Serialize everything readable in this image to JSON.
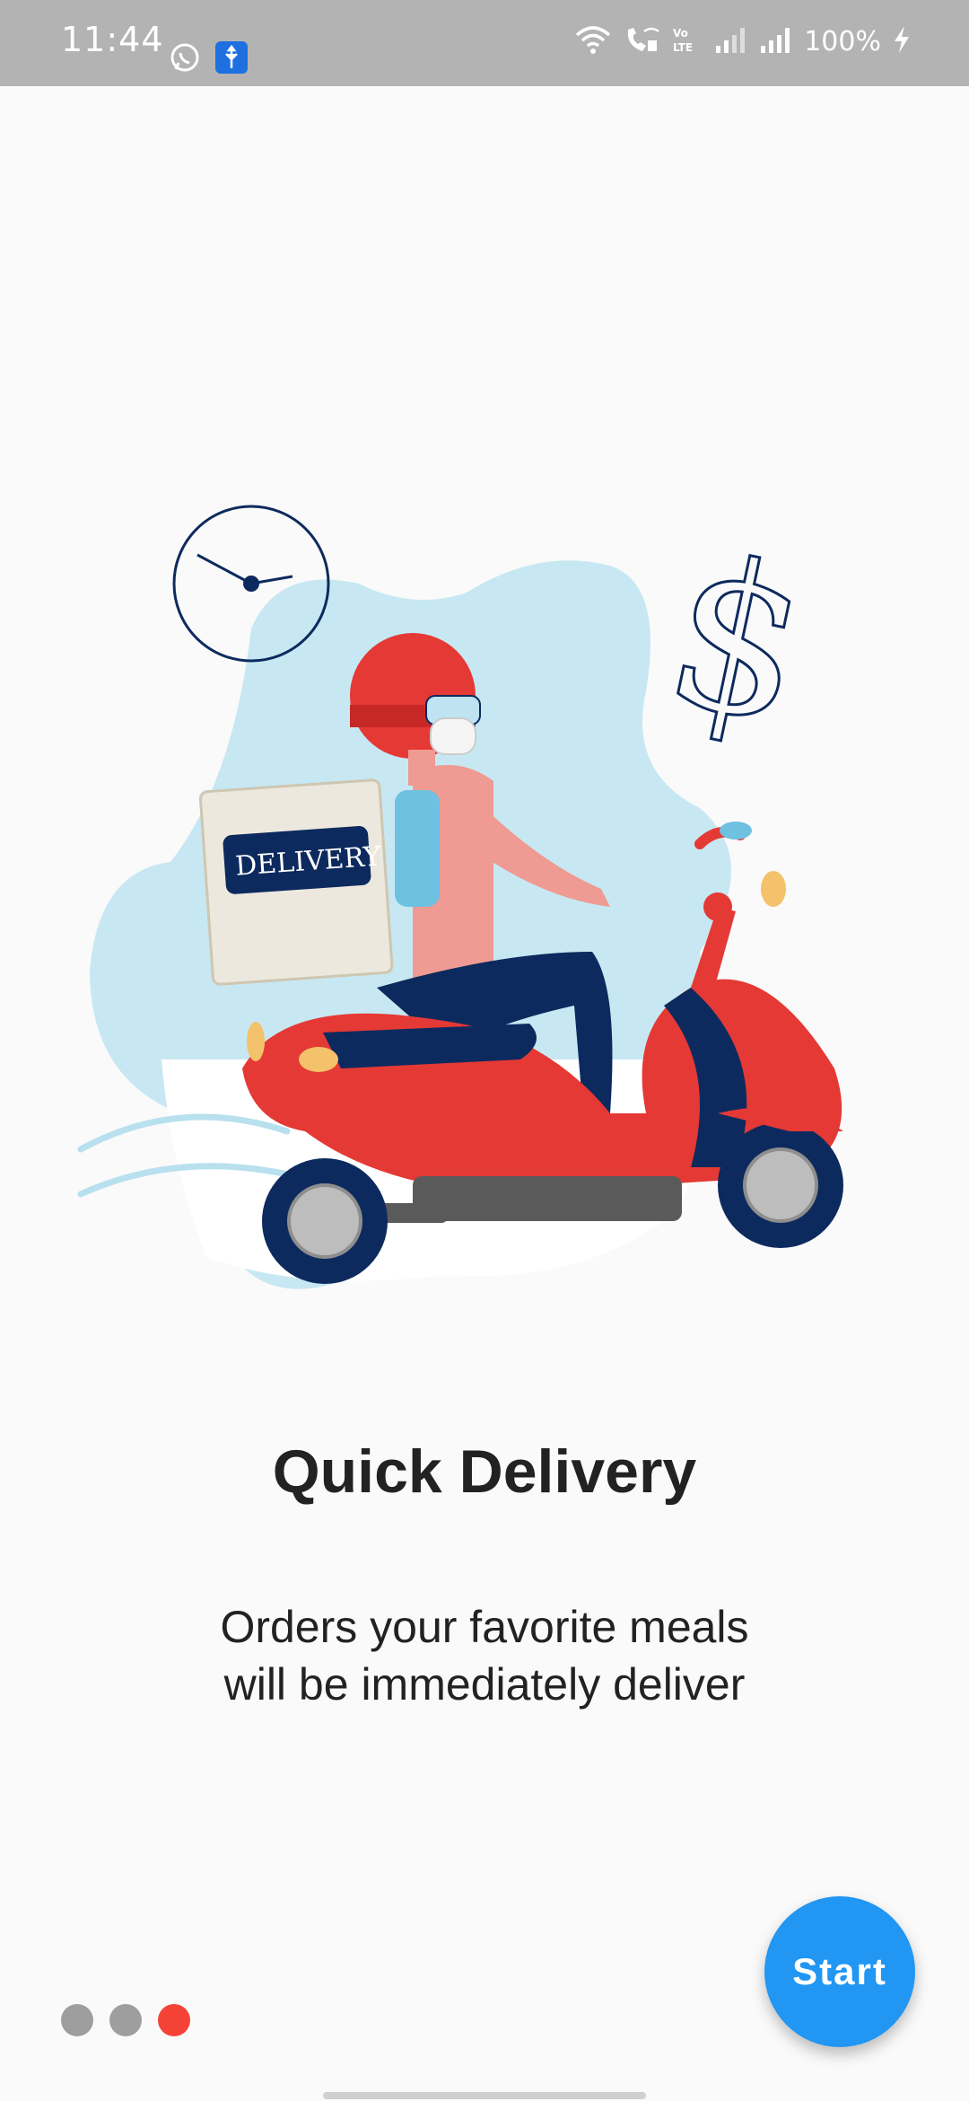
{
  "status_bar": {
    "time": "11:44",
    "battery": "100%",
    "icons": [
      "whatsapp-icon",
      "usb-icon",
      "wifi-icon",
      "wifi-calling-icon",
      "volte-icon",
      "signal-icon",
      "signal-icon",
      "charging-icon"
    ]
  },
  "illustration": {
    "box_text": "DELIVERY",
    "icons": [
      "clock-icon",
      "dollar-icon",
      "scooter-rider-icon"
    ]
  },
  "onboarding": {
    "title": "Quick Delivery",
    "subtitle": "Orders your favorite meals\nwill be  immediately deliver",
    "page_index": 3,
    "page_count": 3
  },
  "actions": {
    "start_label": "Start"
  },
  "colors": {
    "status_bar": "#b3b3b3",
    "accent_blue": "#2196f3",
    "active_dot": "#f44336",
    "inactive_dot": "#9e9e9e",
    "scooter_red": "#e53935",
    "navy": "#0d2a5e",
    "blob": "#c7e8f2"
  }
}
